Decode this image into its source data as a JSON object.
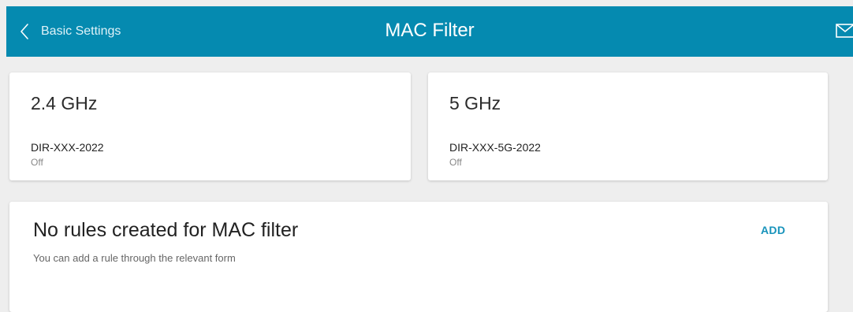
{
  "header": {
    "back_label": "Basic Settings",
    "title": "MAC Filter",
    "back_icon": "chevron-left-icon",
    "mail_icon": "mail-icon"
  },
  "bands": [
    {
      "title": "2.4 GHz",
      "ssid": "DIR-XXX-2022",
      "status": "Off"
    },
    {
      "title": "5 GHz",
      "ssid": "DIR-XXX-5G-2022",
      "status": "Off"
    }
  ],
  "rules": {
    "title": "No rules created for MAC filter",
    "hint": "You can add a rule through the relevant form",
    "add_label": "ADD"
  },
  "colors": {
    "header_bg": "#058ab0",
    "page_bg": "#eeeeee",
    "accent": "#1893bb"
  }
}
